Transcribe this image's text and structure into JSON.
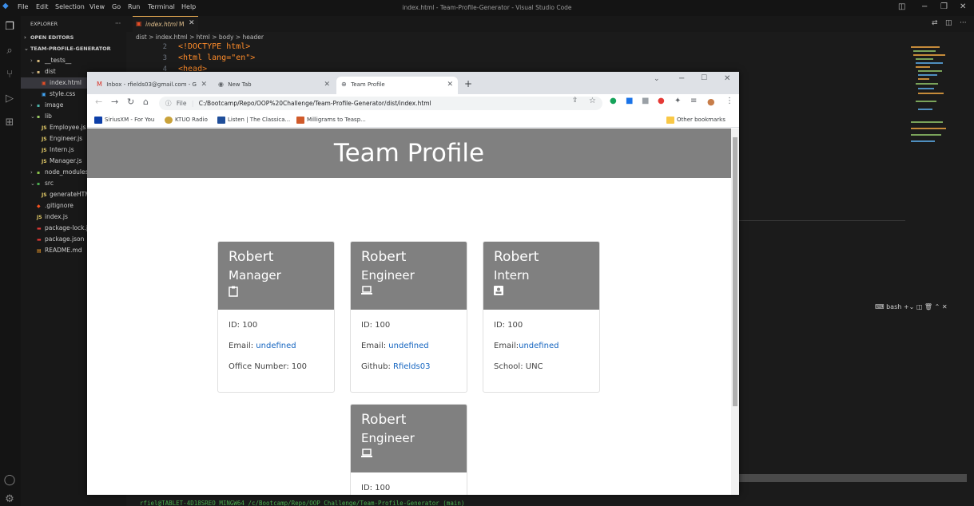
{
  "vscode": {
    "menu": [
      "File",
      "Edit",
      "Selection",
      "View",
      "Go",
      "Run",
      "Terminal",
      "Help"
    ],
    "window_title": "index.html - Team-Profile-Generator - Visual Studio Code",
    "explorer_title": "EXPLORER",
    "explorer_more": "···",
    "open_editors": "OPEN EDITORS",
    "project": "TEAM-PROFILE-GENERATOR",
    "tree": {
      "tests": "__tests__",
      "dist": "dist",
      "index_html": "index.html",
      "style_css": "style.css",
      "image": "image",
      "lib": "lib",
      "employee": "Employee.js",
      "engineer": "Engineer.js",
      "intern": "Intern.js",
      "manager": "Manager.js",
      "node_modules": "node_modules",
      "src": "src",
      "generate": "generateHTML.js",
      "gitignore": ".gitignore",
      "index_js": "index.js",
      "package_lock": "package-lock.json",
      "package_json": "package.json",
      "readme": "README.md"
    },
    "active_tab": "index.html",
    "tab_modified": "M",
    "breadcrumb": "dist > index.html > html > body > header",
    "code": [
      {
        "n": "2",
        "text": "<!DOCTYPE html>"
      },
      {
        "n": "3",
        "text": "<html lang=\"en\">"
      },
      {
        "n": "4",
        "text": "<head>"
      }
    ],
    "panel_label": "bash",
    "terminal_prompt": "rfiel@TABLET-4D18SREO MINGW64 /c/Bootcamp/Repo/OOP_Challenge/Team-Profile-Generator (main)",
    "colors": {
      "accent_orange": "#e8ab53",
      "sidebar_bg": "#181818",
      "editor_bg": "#1b1b1b"
    }
  },
  "browser": {
    "tabs": [
      {
        "label": "Inbox - rfields03@gmail.com - G",
        "icon": "gmail-icon"
      },
      {
        "label": "New Tab",
        "icon": "chrome-icon"
      },
      {
        "label": "Team Profile",
        "icon": "globe-icon"
      }
    ],
    "new_tab_symbol": "+",
    "url_scheme": "File",
    "url": "C:/Bootcamp/Repo/OOP%20Challenge/Team-Profile-Generator/dist/index.html",
    "bookmarks": [
      "SiriusXM - For You",
      "KTUO Radio",
      "Listen | The Classica...",
      "Milligrams to Teasp..."
    ],
    "other_bookmarks": "Other bookmarks"
  },
  "page": {
    "title": "Team Profile",
    "header_bg": "#808080",
    "link_color": "#1565c0",
    "cards": [
      {
        "name": "Robert",
        "role": "Manager",
        "icon": "clipboard-icon",
        "id_line": "ID: 100",
        "email_label": "Email: ",
        "email": "undefined",
        "extra_label": "Office Number: 100",
        "extra_link": ""
      },
      {
        "name": "Robert",
        "role": "Engineer",
        "icon": "laptop-icon",
        "id_line": "ID: 100",
        "email_label": "Email: ",
        "email": "undefined",
        "extra_label": "Github: ",
        "extra_link": "Rfields03"
      },
      {
        "name": "Robert",
        "role": "Intern",
        "icon": "id-badge-icon",
        "id_line": "ID: 100",
        "email_label": "Email:",
        "email": "undefined",
        "extra_label": "School: UNC",
        "extra_link": ""
      },
      {
        "name": "Robert",
        "role": "Engineer",
        "icon": "laptop-icon",
        "id_line": "ID: 100"
      }
    ]
  }
}
